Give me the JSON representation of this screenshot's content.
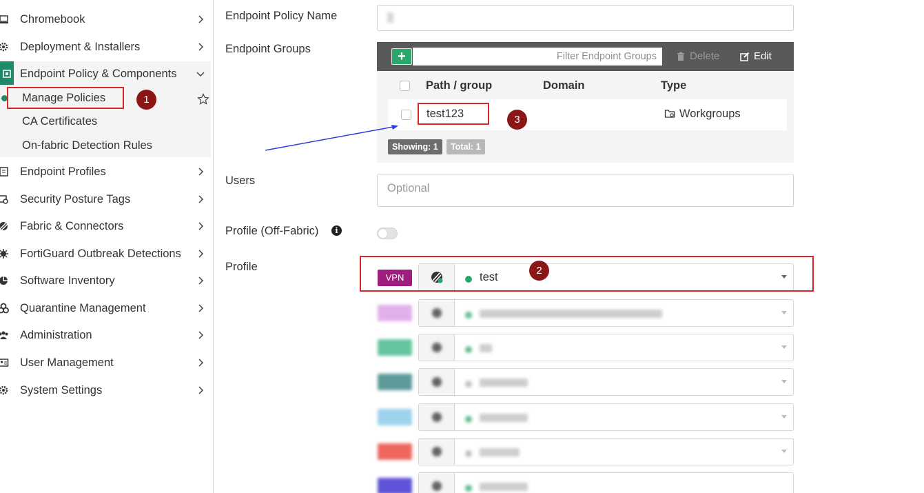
{
  "sidebar": {
    "items": [
      {
        "label": "Chromebook",
        "icon": "chromebook-icon"
      },
      {
        "label": "Deployment & Installers",
        "icon": "gear-icon"
      },
      {
        "label": "Endpoint Policy & Components",
        "icon": "endpoint-policy-icon"
      },
      {
        "label": "Endpoint Profiles",
        "icon": "profile-icon"
      },
      {
        "label": "Security Posture Tags",
        "icon": "tag-icon"
      },
      {
        "label": "Fabric & Connectors",
        "icon": "fabric-icon"
      },
      {
        "label": "FortiGuard Outbreak Detections",
        "icon": "outbreak-icon"
      },
      {
        "label": "Software Inventory",
        "icon": "software-icon"
      },
      {
        "label": "Quarantine Management",
        "icon": "biohazard-icon"
      },
      {
        "label": "Administration",
        "icon": "users-icon"
      },
      {
        "label": "User Management",
        "icon": "user-card-icon"
      },
      {
        "label": "System Settings",
        "icon": "gear-icon"
      }
    ],
    "submenu": [
      {
        "label": "Manage Policies"
      },
      {
        "label": "CA Certificates"
      },
      {
        "label": "On-fabric Detection Rules"
      }
    ]
  },
  "form": {
    "policy_name_label": "Endpoint Policy Name",
    "groups_label": "Endpoint Groups",
    "users_label": "Users",
    "users_placeholder": "Optional",
    "profile_offfabric_label": "Profile (Off-Fabric)",
    "profile_label": "Profile"
  },
  "groups": {
    "filter_placeholder": "Filter Endpoint Groups",
    "delete_label": "Delete",
    "edit_label": "Edit",
    "columns": [
      "Path / group",
      "Domain",
      "Type"
    ],
    "rows": [
      {
        "path": "test123",
        "domain": "",
        "type": "Workgroups"
      }
    ],
    "showing": "Showing: 1",
    "total": "Total: 1"
  },
  "profiles": [
    {
      "tag": "VPN",
      "tag_color": "#a01c7f",
      "name": "test",
      "blurred": false
    },
    {
      "tag": "",
      "tag_color": "#d896e6",
      "name": "",
      "blurred": true
    },
    {
      "tag": "",
      "tag_color": "#33b27f",
      "name": "",
      "blurred": true
    },
    {
      "tag": "",
      "tag_color": "#267a78",
      "name": "",
      "blurred": true
    },
    {
      "tag": "",
      "tag_color": "#7fc3e6",
      "name": "",
      "blurred": true
    },
    {
      "tag": "",
      "tag_color": "#e8352b",
      "name": "",
      "blurred": true
    },
    {
      "tag": "",
      "tag_color": "#2a1acb",
      "name": "",
      "blurred": true
    }
  ],
  "annotations": [
    "1",
    "2",
    "3"
  ],
  "colors": {
    "accent": "#1f8a6a",
    "annotation_red": "#d9262a",
    "annotation_badge": "#8b1616"
  }
}
